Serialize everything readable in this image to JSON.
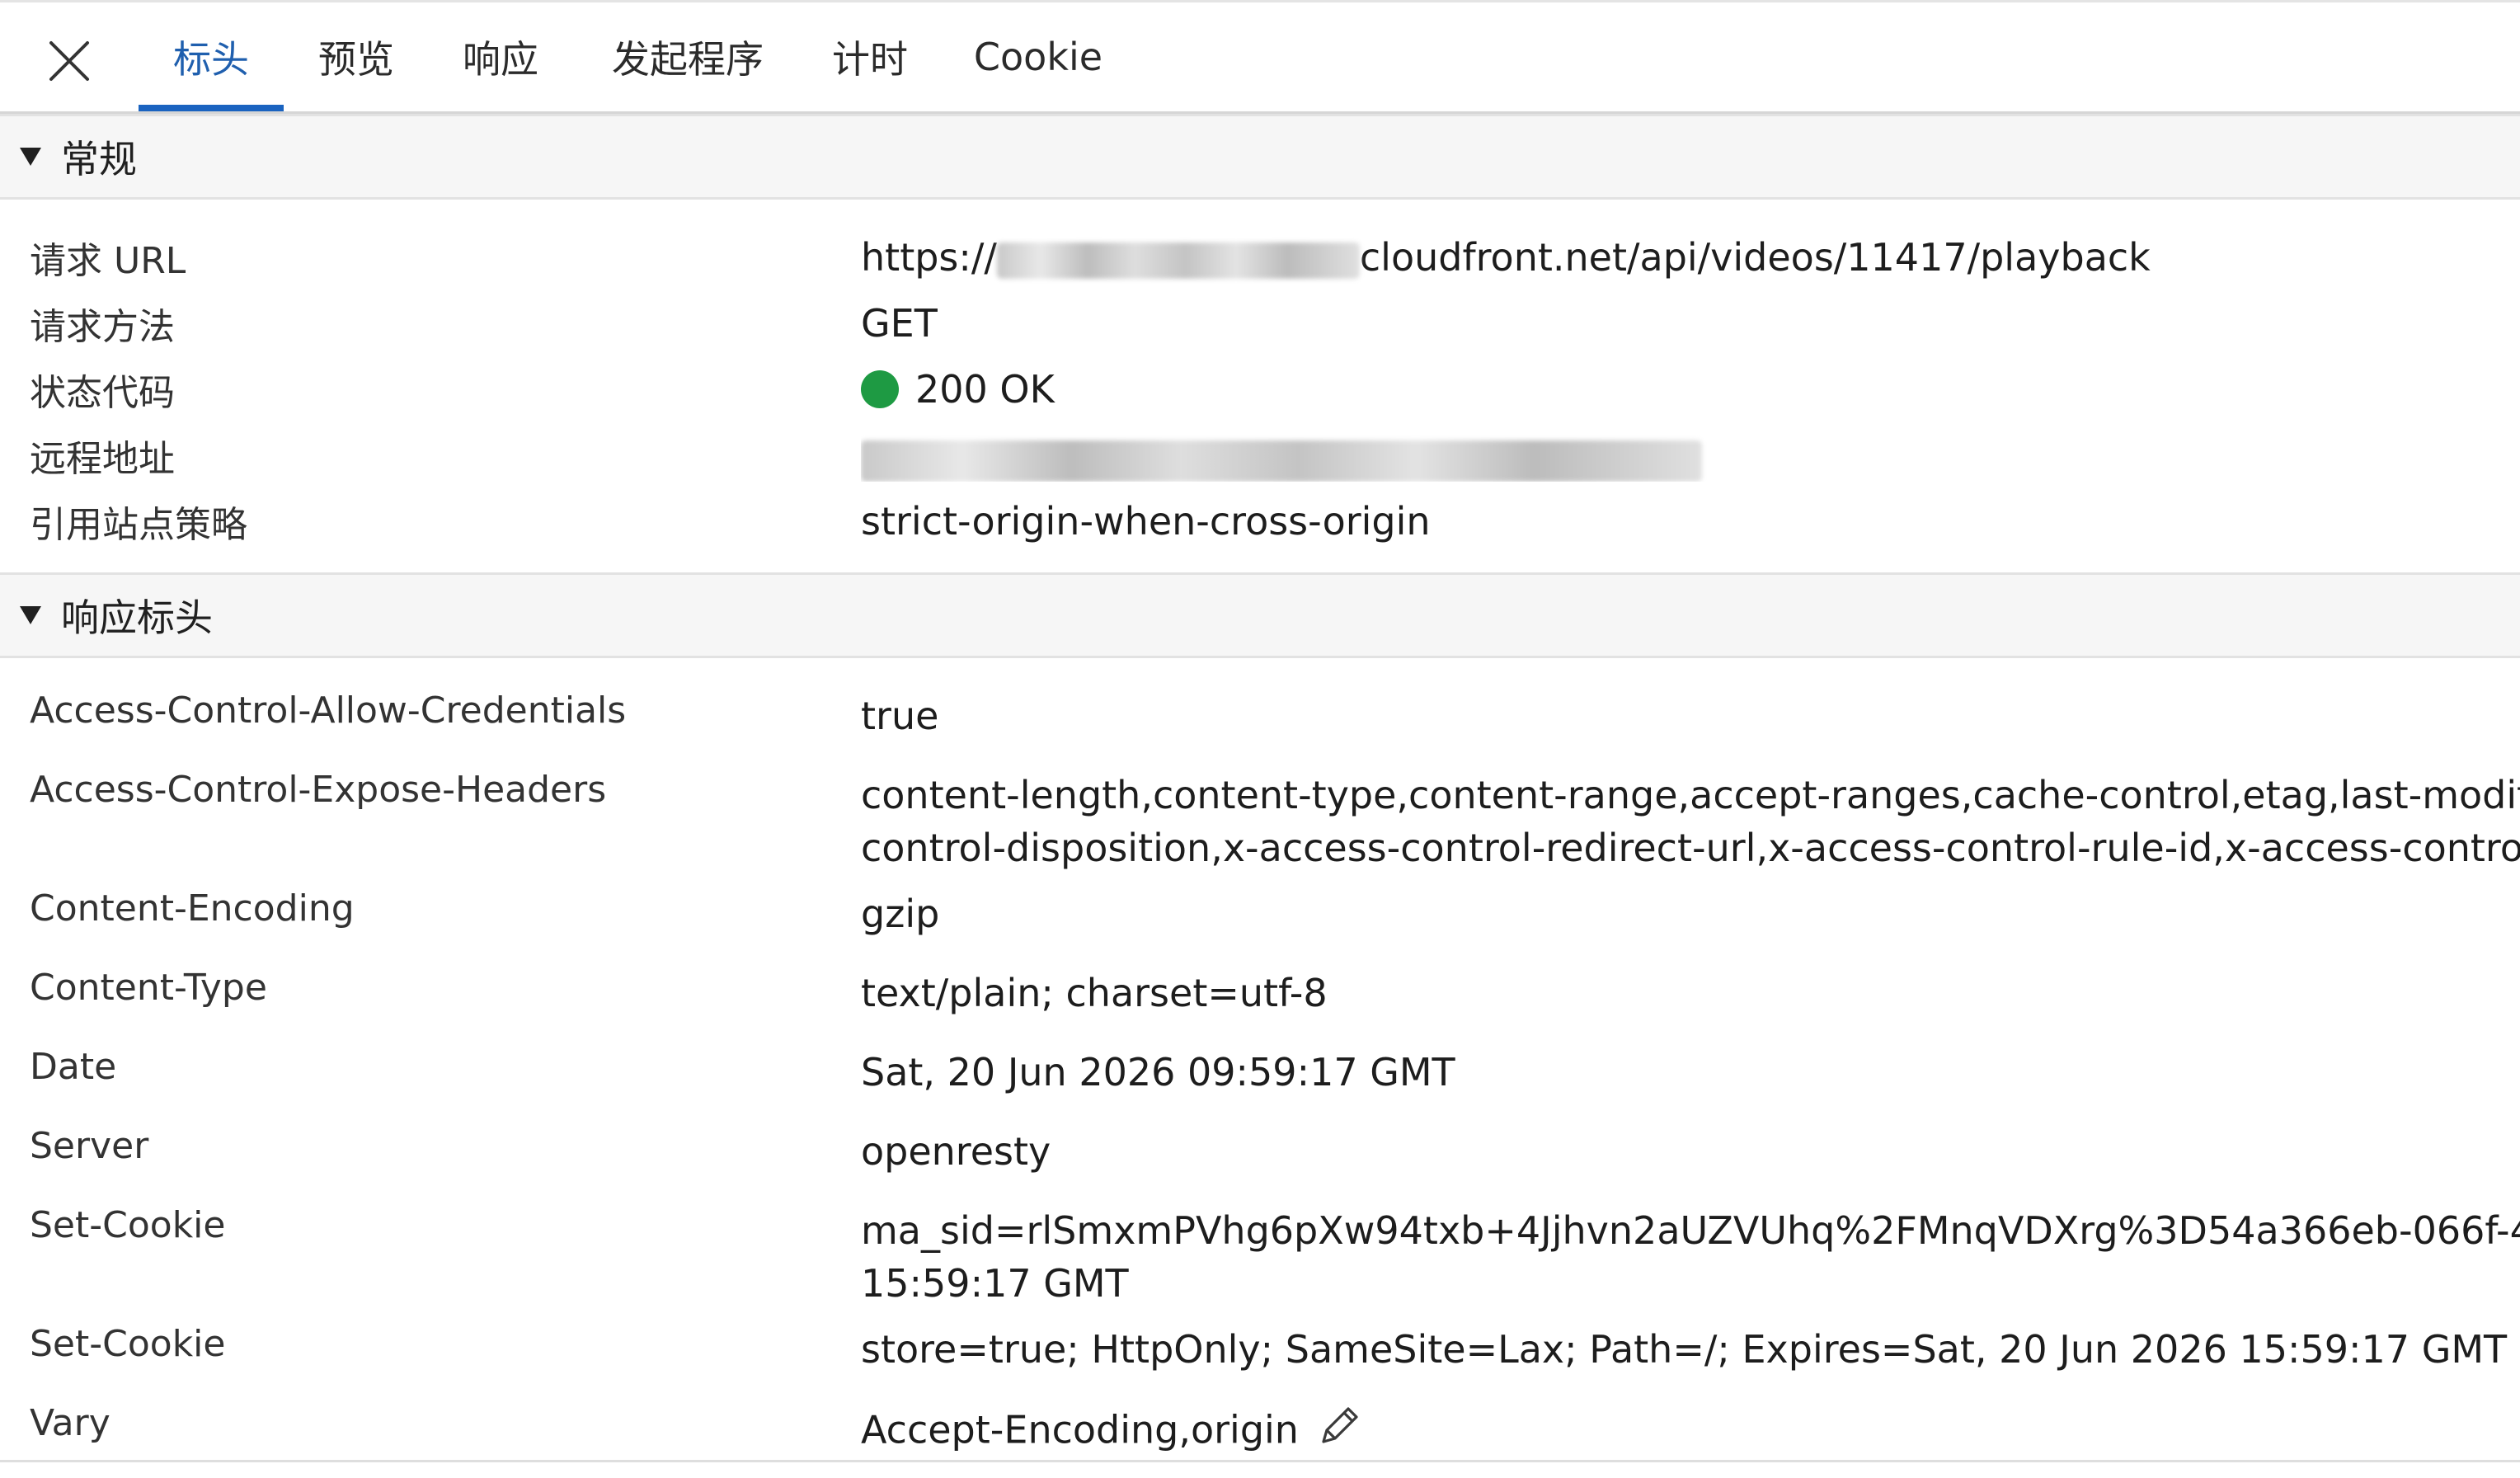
{
  "tabs": [
    {
      "label": "标头",
      "active": true
    },
    {
      "label": "预览",
      "active": false
    },
    {
      "label": "响应",
      "active": false
    },
    {
      "label": "发起程序",
      "active": false
    },
    {
      "label": "计时",
      "active": false
    },
    {
      "label": "Cookie",
      "active": false
    }
  ],
  "general": {
    "title": "常规",
    "rows": [
      {
        "key": "请求 URL",
        "value_prefix": "https://",
        "value_suffix": "cloudfront.net/api/videos/11417/playback"
      },
      {
        "key": "请求方法",
        "value": "GET"
      },
      {
        "key": "状态代码",
        "value": "200 OK"
      },
      {
        "key": "远程地址",
        "value": ""
      },
      {
        "key": "引用站点策略",
        "value": "strict-origin-when-cross-origin"
      }
    ]
  },
  "response_headers": {
    "title": "响应标头",
    "rows": [
      {
        "key": "Access-Control-Allow-Credentials",
        "lines": [
          "true"
        ]
      },
      {
        "key": "Access-Control-Expose-Headers",
        "lines": [
          "content-length,content-type,content-range,accept-ranges,cache-control,etag,last-modif",
          "control-disposition,x-access-control-redirect-url,x-access-control-rule-id,x-access-contro"
        ]
      },
      {
        "key": "Content-Encoding",
        "lines": [
          "gzip"
        ]
      },
      {
        "key": "Content-Type",
        "lines": [
          "text/plain; charset=utf-8"
        ]
      },
      {
        "key": "Date",
        "lines": [
          "Sat, 20 Jun 2026 09:59:17 GMT"
        ]
      },
      {
        "key": "Server",
        "lines": [
          "openresty"
        ]
      },
      {
        "key": "Set-Cookie",
        "lines": [
          "ma_sid=rlSmxmPVhg6pXw94txb+4Jjhvn2aUZVUhq%2FMnqVDXrg%3D54a366eb-066f-4",
          "15:59:17 GMT"
        ]
      },
      {
        "key": "Set-Cookie",
        "lines": [
          "store=true; HttpOnly; SameSite=Lax; Path=/; Expires=Sat, 20 Jun 2026 15:59:17 GMT"
        ]
      },
      {
        "key": "Vary",
        "lines": [
          "Accept-Encoding,origin"
        ]
      }
    ]
  },
  "colors": {
    "accent": "#1a63c0",
    "status_ok": "#1e9a43"
  },
  "icons": {
    "close": "close-icon",
    "edit": "pencil-icon",
    "caret": "caret-down-icon",
    "status": "status-dot-icon"
  }
}
